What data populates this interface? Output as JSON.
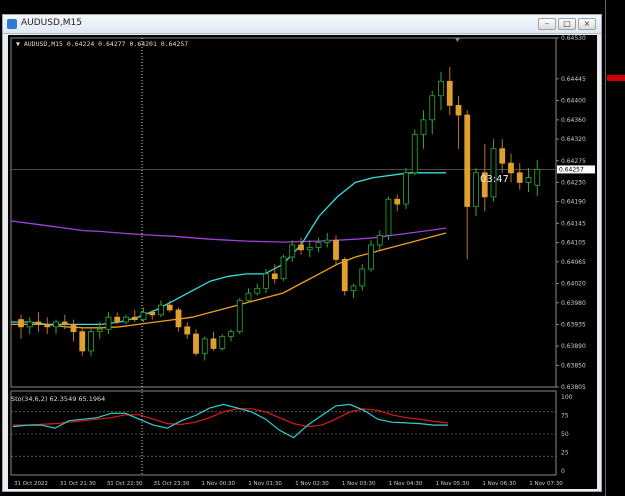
{
  "window": {
    "title": "AUDUSD,M15"
  },
  "chart": {
    "symbol_line": "AUDUSD,M15  0.64224 0.64277 0.64201 0.64257",
    "current_price": "0.64257",
    "countdown": "03:47",
    "price_axis": [
      "0.64530",
      "0.64445",
      "0.64400",
      "0.64360",
      "0.64320",
      "0.64275",
      "0.64230",
      "0.64190",
      "0.64145",
      "0.64105",
      "0.64065",
      "0.64020",
      "0.63980",
      "0.63935",
      "0.63890",
      "0.63850",
      "0.63805"
    ],
    "time_axis": [
      "31 Oct 2022",
      "31 Oct 21:30",
      "31 Oct 22:30",
      "31 Oct 23:30",
      "1 Nov 00:30",
      "1 Nov 01:30",
      "1 Nov 02:30",
      "1 Nov 03:30",
      "1 Nov 04:30",
      "1 Nov 05:30",
      "1 Nov 06:30",
      "1 Nov 07:30"
    ],
    "osc_label": "Sto(34,6,2) 62.3549 65.1964",
    "osc_axis": [
      "100",
      "75",
      "50",
      "25",
      "0"
    ]
  },
  "chart_data": {
    "type": "candlestick",
    "ylim": [
      0.63805,
      0.6453
    ],
    "candles": [
      {
        "o": 0.63945,
        "h": 0.63955,
        "l": 0.63905,
        "c": 0.6393
      },
      {
        "o": 0.6393,
        "h": 0.6395,
        "l": 0.63915,
        "c": 0.6394
      },
      {
        "o": 0.6394,
        "h": 0.6396,
        "l": 0.6392,
        "c": 0.63935
      },
      {
        "o": 0.63935,
        "h": 0.6395,
        "l": 0.63915,
        "c": 0.6393
      },
      {
        "o": 0.6393,
        "h": 0.63945,
        "l": 0.63915,
        "c": 0.6394
      },
      {
        "o": 0.6394,
        "h": 0.63955,
        "l": 0.63925,
        "c": 0.63935
      },
      {
        "o": 0.63935,
        "h": 0.63945,
        "l": 0.639,
        "c": 0.6392
      },
      {
        "o": 0.6392,
        "h": 0.6393,
        "l": 0.6387,
        "c": 0.6388
      },
      {
        "o": 0.6388,
        "h": 0.6393,
        "l": 0.6387,
        "c": 0.6392
      },
      {
        "o": 0.6392,
        "h": 0.6394,
        "l": 0.63905,
        "c": 0.63925
      },
      {
        "o": 0.63925,
        "h": 0.6396,
        "l": 0.63915,
        "c": 0.6395
      },
      {
        "o": 0.6395,
        "h": 0.6396,
        "l": 0.63935,
        "c": 0.6394
      },
      {
        "o": 0.6394,
        "h": 0.63955,
        "l": 0.63935,
        "c": 0.6395
      },
      {
        "o": 0.6395,
        "h": 0.63965,
        "l": 0.6394,
        "c": 0.63945
      },
      {
        "o": 0.63945,
        "h": 0.6397,
        "l": 0.6394,
        "c": 0.6396
      },
      {
        "o": 0.6396,
        "h": 0.63965,
        "l": 0.63945,
        "c": 0.63955
      },
      {
        "o": 0.63955,
        "h": 0.63985,
        "l": 0.6395,
        "c": 0.63975
      },
      {
        "o": 0.63975,
        "h": 0.63985,
        "l": 0.6396,
        "c": 0.63965
      },
      {
        "o": 0.63965,
        "h": 0.6397,
        "l": 0.6392,
        "c": 0.6393
      },
      {
        "o": 0.6393,
        "h": 0.6394,
        "l": 0.63905,
        "c": 0.63915
      },
      {
        "o": 0.63915,
        "h": 0.63925,
        "l": 0.6387,
        "c": 0.63875
      },
      {
        "o": 0.63875,
        "h": 0.6391,
        "l": 0.6386,
        "c": 0.63905
      },
      {
        "o": 0.63905,
        "h": 0.6392,
        "l": 0.6388,
        "c": 0.63885
      },
      {
        "o": 0.63885,
        "h": 0.63915,
        "l": 0.6388,
        "c": 0.6391
      },
      {
        "o": 0.6391,
        "h": 0.63925,
        "l": 0.639,
        "c": 0.6392
      },
      {
        "o": 0.6392,
        "h": 0.6399,
        "l": 0.63915,
        "c": 0.63985
      },
      {
        "o": 0.63985,
        "h": 0.6401,
        "l": 0.6398,
        "c": 0.64
      },
      {
        "o": 0.64,
        "h": 0.6402,
        "l": 0.63995,
        "c": 0.6401
      },
      {
        "o": 0.6401,
        "h": 0.6405,
        "l": 0.64,
        "c": 0.6404
      },
      {
        "o": 0.6404,
        "h": 0.6406,
        "l": 0.6402,
        "c": 0.6403
      },
      {
        "o": 0.6403,
        "h": 0.6408,
        "l": 0.64025,
        "c": 0.64075
      },
      {
        "o": 0.64075,
        "h": 0.6411,
        "l": 0.64065,
        "c": 0.641
      },
      {
        "o": 0.641,
        "h": 0.64115,
        "l": 0.6408,
        "c": 0.6409
      },
      {
        "o": 0.6409,
        "h": 0.6411,
        "l": 0.64075,
        "c": 0.64095
      },
      {
        "o": 0.64095,
        "h": 0.64115,
        "l": 0.64085,
        "c": 0.64105
      },
      {
        "o": 0.64105,
        "h": 0.64125,
        "l": 0.64095,
        "c": 0.6411
      },
      {
        "o": 0.6411,
        "h": 0.6412,
        "l": 0.6406,
        "c": 0.6407
      },
      {
        "o": 0.6407,
        "h": 0.64075,
        "l": 0.63995,
        "c": 0.64005
      },
      {
        "o": 0.64005,
        "h": 0.6402,
        "l": 0.6399,
        "c": 0.64015
      },
      {
        "o": 0.64015,
        "h": 0.6406,
        "l": 0.64005,
        "c": 0.6405
      },
      {
        "o": 0.6405,
        "h": 0.6411,
        "l": 0.64045,
        "c": 0.641
      },
      {
        "o": 0.641,
        "h": 0.6413,
        "l": 0.6409,
        "c": 0.6412
      },
      {
        "o": 0.6412,
        "h": 0.642,
        "l": 0.6411,
        "c": 0.64195
      },
      {
        "o": 0.64195,
        "h": 0.64205,
        "l": 0.6417,
        "c": 0.64185
      },
      {
        "o": 0.64185,
        "h": 0.6426,
        "l": 0.64175,
        "c": 0.6425
      },
      {
        "o": 0.6425,
        "h": 0.6434,
        "l": 0.64245,
        "c": 0.6433
      },
      {
        "o": 0.6433,
        "h": 0.6438,
        "l": 0.643,
        "c": 0.6436
      },
      {
        "o": 0.6436,
        "h": 0.6442,
        "l": 0.6433,
        "c": 0.6441
      },
      {
        "o": 0.6441,
        "h": 0.6446,
        "l": 0.6438,
        "c": 0.6444
      },
      {
        "o": 0.6444,
        "h": 0.6447,
        "l": 0.6437,
        "c": 0.6439
      },
      {
        "o": 0.6439,
        "h": 0.6441,
        "l": 0.643,
        "c": 0.6437
      },
      {
        "o": 0.6437,
        "h": 0.6438,
        "l": 0.6407,
        "c": 0.6418
      },
      {
        "o": 0.6418,
        "h": 0.6426,
        "l": 0.6416,
        "c": 0.6425
      },
      {
        "o": 0.6425,
        "h": 0.6431,
        "l": 0.6417,
        "c": 0.642
      },
      {
        "o": 0.642,
        "h": 0.6432,
        "l": 0.6419,
        "c": 0.643
      },
      {
        "o": 0.643,
        "h": 0.6432,
        "l": 0.6425,
        "c": 0.6427
      },
      {
        "o": 0.6427,
        "h": 0.6429,
        "l": 0.6423,
        "c": 0.6425
      },
      {
        "o": 0.6425,
        "h": 0.6427,
        "l": 0.64215,
        "c": 0.6423
      },
      {
        "o": 0.6423,
        "h": 0.6426,
        "l": 0.6421,
        "c": 0.6424
      },
      {
        "o": 0.64224,
        "h": 0.64277,
        "l": 0.64201,
        "c": 0.64257
      }
    ],
    "bull_color": "#2fa82f",
    "bear_color": "#e0a030",
    "ma_purple": [
      0.6415,
      0.64145,
      0.6414,
      0.64135,
      0.6413,
      0.64128,
      0.64125,
      0.64122,
      0.6412,
      0.64118,
      0.64115,
      0.64112,
      0.6411,
      0.64108,
      0.64107,
      0.64106,
      0.64107,
      0.64108,
      0.6411,
      0.64112,
      0.64115,
      0.6412,
      0.64125,
      0.6413,
      0.64135
    ],
    "ma_cyan": [
      0.6394,
      0.6394,
      0.63935,
      0.63935,
      0.63935,
      0.63935,
      0.6394,
      0.6395,
      0.63965,
      0.63985,
      0.64005,
      0.64025,
      0.64035,
      0.6404,
      0.6404,
      0.6406,
      0.641,
      0.6416,
      0.642,
      0.6423,
      0.6424,
      0.64245,
      0.6425,
      0.6425,
      0.6425
    ],
    "ma_orange": [
      0.63935,
      0.63935,
      0.63935,
      0.6393,
      0.63928,
      0.63928,
      0.6393,
      0.63935,
      0.6394,
      0.63945,
      0.6395,
      0.6396,
      0.6397,
      0.6398,
      0.6399,
      0.64,
      0.6402,
      0.6404,
      0.6406,
      0.64075,
      0.64085,
      0.64095,
      0.64105,
      0.64115,
      0.64125
    ],
    "sto_main": [
      60,
      62,
      62,
      58,
      68,
      70,
      72,
      78,
      78,
      70,
      62,
      58,
      68,
      75,
      85,
      90,
      85,
      80,
      70,
      55,
      45,
      62,
      75,
      88,
      90,
      82,
      70,
      66,
      65,
      64,
      62,
      62
    ],
    "sto_signal": [
      62,
      62,
      63,
      64,
      66,
      68,
      70,
      72,
      76,
      76,
      70,
      64,
      63,
      66,
      72,
      80,
      84,
      84,
      80,
      72,
      64,
      60,
      62,
      70,
      80,
      84,
      82,
      76,
      72,
      70,
      67,
      65
    ],
    "sto_levels": [
      80,
      50,
      20
    ]
  }
}
